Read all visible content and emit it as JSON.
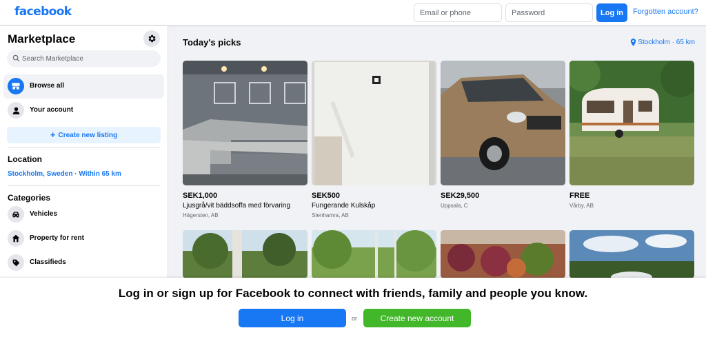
{
  "header": {
    "logo": "facebook",
    "email_placeholder": "Email or phone",
    "password_placeholder": "Password",
    "login_label": "Log in",
    "forgot_label": "Forgotten account?"
  },
  "sidebar": {
    "title": "Marketplace",
    "search_placeholder": "Search Marketplace",
    "nav": [
      {
        "label": "Browse all",
        "icon": "store-icon"
      },
      {
        "label": "Your account",
        "icon": "person-icon"
      }
    ],
    "create_listing_label": "Create new listing",
    "location_heading": "Location",
    "location_value": "Stockholm, Sweden · Within 65 km",
    "categories_heading": "Categories",
    "categories": [
      {
        "label": "Vehicles",
        "icon": "car-icon"
      },
      {
        "label": "Property for rent",
        "icon": "house-icon"
      },
      {
        "label": "Classifieds",
        "icon": "tag-icon"
      }
    ]
  },
  "main": {
    "section_title": "Today's picks",
    "location_badge": "Stockholm · 65 km",
    "listings": [
      {
        "price": "SEK1,000",
        "title": "Ljusgrå/vit bäddsoffa med förvaring",
        "location": "Hägersten, AB",
        "image": "sofa"
      },
      {
        "price": "SEK500",
        "title": "Fungerande Kulskåp",
        "location": "Stenhamra, AB",
        "image": "fridge"
      },
      {
        "price": "SEK29,500",
        "title": "",
        "location": "Uppsala, C",
        "image": "car"
      },
      {
        "price": "FREE",
        "title": "",
        "location": "Vårby, AB",
        "image": "caravan"
      }
    ]
  },
  "banner": {
    "text": "Log in or sign up for Facebook to connect with friends, family and people you know.",
    "login_label": "Log in",
    "or_label": "or",
    "create_label": "Create new account"
  },
  "colors": {
    "brand": "#1877f2",
    "create_account_green": "#42b72a",
    "page_bg": "#f0f2f5"
  }
}
